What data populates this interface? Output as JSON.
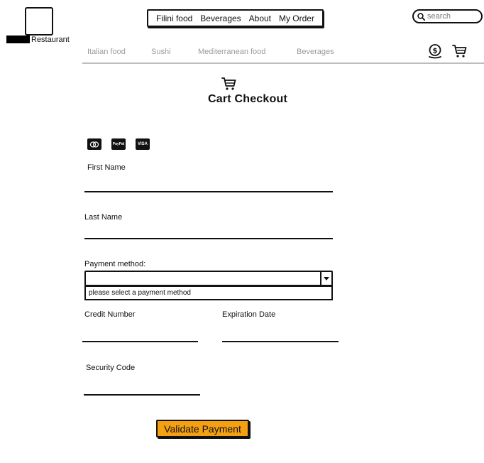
{
  "brand": {
    "logo_text": "Restaurant"
  },
  "top_nav": {
    "items": [
      "Filini food",
      "Beverages",
      "About",
      "My Order"
    ]
  },
  "search": {
    "placeholder": "search"
  },
  "categories": [
    "Italian food",
    "Sushi",
    "Mediterranean food",
    "Beverages"
  ],
  "header_icons": [
    "money-bag-icon",
    "shopping-cart-icon"
  ],
  "checkout": {
    "title": "Cart Checkout",
    "title_icon": "shopping-cart-icon",
    "payment_cards": [
      {
        "name": "mastercard",
        "label": ""
      },
      {
        "name": "paypal",
        "label": "PayPal"
      },
      {
        "name": "visa",
        "label": "VISA"
      }
    ],
    "first_name": {
      "label": "First Name",
      "value": ""
    },
    "last_name": {
      "label": "Last Name",
      "value": ""
    },
    "payment_method": {
      "label": "Payment method:",
      "value": "",
      "option": "please select a payment method"
    },
    "credit_number": {
      "label": "Credit Number",
      "value": ""
    },
    "expiration_date": {
      "label": "Expiration Date",
      "value": ""
    },
    "security_code": {
      "label": "Security Code",
      "value": ""
    },
    "validate_button": "Validate Payment"
  },
  "colors": {
    "accent": "#f4a012",
    "muted_text": "#9a9a9a",
    "divider": "#bdbdbd"
  }
}
